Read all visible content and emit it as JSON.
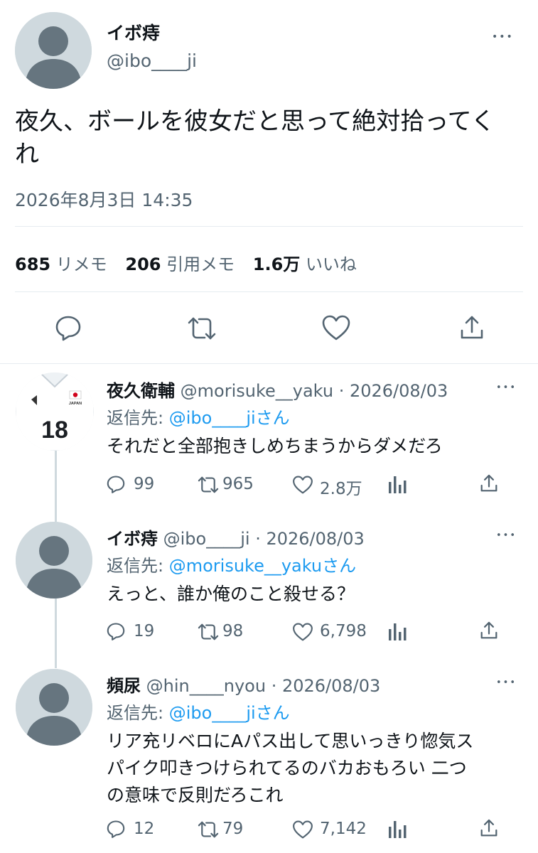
{
  "main_tweet": {
    "display_name": "イボ痔",
    "handle": "@ibo____ji",
    "text_line1": "夜久、ボールを彼女だと思って絶対拾ってく",
    "text_line2": "れ",
    "timestamp": "2026年8月3日 14:35",
    "stats": {
      "retweets_count": "685",
      "retweets_label": "リメモ",
      "quotes_count": "206",
      "quotes_label": "引用メモ",
      "likes_count": "1.6万",
      "likes_label": "いいね"
    },
    "more_glyph": "•••"
  },
  "replies": [
    {
      "display_name": "夜久衛輔",
      "handle": "@morisuke__yaku",
      "date": "· 2026/08/03",
      "reply_to_label": "返信先:",
      "reply_to_handle": "@ibo____jiさん",
      "text_lines": [
        "それだと全部抱きしめちまうからダメだろ"
      ],
      "replies": "99",
      "retweets": "965",
      "likes": "2.8万",
      "avatar_jersey_number": "18",
      "avatar_jersey_text": "JAPAN",
      "more_glyph": "•••"
    },
    {
      "display_name": "イボ痔",
      "handle": "@ibo____ji",
      "date": "· 2026/08/03",
      "reply_to_label": "返信先:",
      "reply_to_handle": "@morisuke__yakuさん",
      "text_lines": [
        "えっと、誰か俺のこと殺せる？"
      ],
      "replies": "19",
      "retweets": "98",
      "likes": "6,798",
      "more_glyph": "•••"
    },
    {
      "display_name": "頻尿",
      "handle": "@hin____nyou",
      "date": "· 2026/08/03",
      "reply_to_label": "返信先:",
      "reply_to_handle": "@ibo____jiさん",
      "text_lines": [
        "リア充リベロにAパス出して思いっきり惚気ス",
        "パイク叩きつけられてるのバカおもろい 二つ",
        "の意味で反則だろこれ"
      ],
      "replies": "12",
      "retweets": "79",
      "likes": "7,142",
      "more_glyph": "•••"
    }
  ],
  "colors": {
    "link": "#1d9bf0",
    "muted": "#536471",
    "text": "#0f1419",
    "avatar_bg": "#cfd9de",
    "avatar_fg": "#536471",
    "thread_line": "#cfd9de"
  },
  "icons": {
    "reply": "speech-bubble-icon",
    "retweet": "retweet-arrows-icon",
    "like": "heart-icon",
    "analytics": "bar-chart-icon",
    "share": "share-upload-icon",
    "more": "more-dots-icon"
  }
}
